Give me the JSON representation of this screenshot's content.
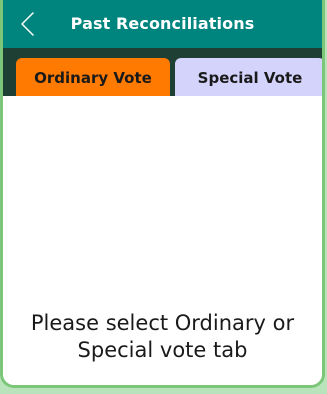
{
  "header": {
    "title": "Past Reconciliations",
    "back_icon": "chevron-left-icon"
  },
  "tabs": [
    {
      "label": "Ordinary Vote",
      "active": true,
      "color": "#ff7a00"
    },
    {
      "label": "Special Vote",
      "active": false,
      "color": "#d4d3fb"
    }
  ],
  "content": {
    "message": "Please select Ordinary or Special vote tab"
  },
  "colors": {
    "header": "#00857e",
    "tabbar": "#1e3f34",
    "frame": "#7bc678",
    "background": "#b9e3ba"
  }
}
